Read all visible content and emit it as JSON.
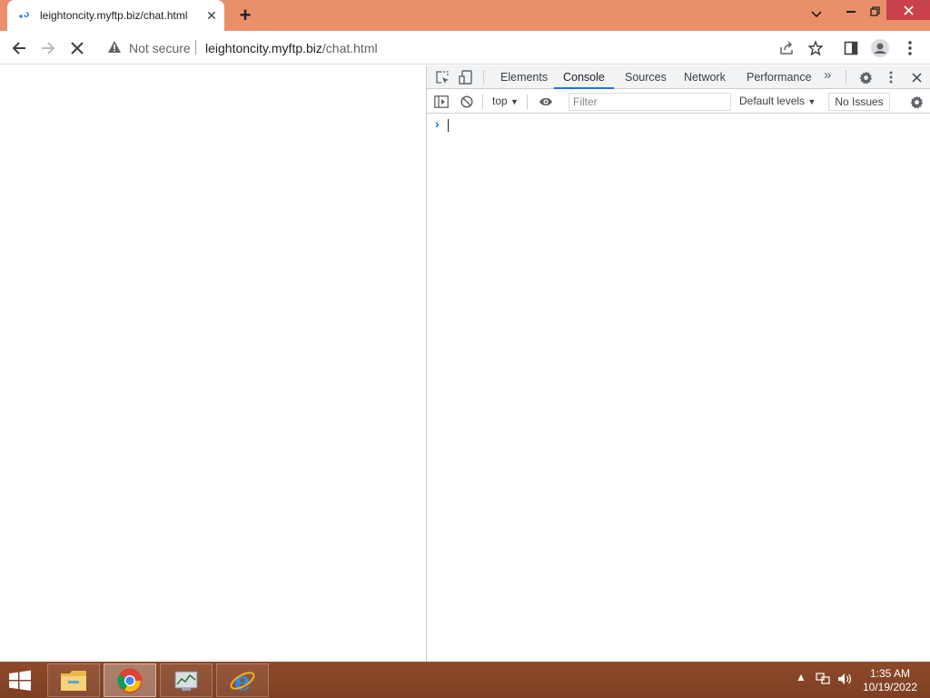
{
  "browser": {
    "tab": {
      "title": "leightoncity.myftp.biz/chat.html",
      "favicon": "loading-favicon-icon"
    },
    "omnibox": {
      "security_label": "Not secure",
      "url_host": "leightoncity.myftp.biz",
      "url_path": "/chat.html"
    },
    "colors": {
      "frame": "#e9906a",
      "close_button": "#c9424b",
      "accent": "#1a73e8"
    }
  },
  "devtools": {
    "tabs": [
      {
        "label": "Elements",
        "active": false
      },
      {
        "label": "Console",
        "active": true
      },
      {
        "label": "Sources",
        "active": false
      },
      {
        "label": "Network",
        "active": false
      },
      {
        "label": "Performance",
        "active": false
      }
    ],
    "toolbar": {
      "context": "top",
      "filter_placeholder": "Filter",
      "levels": "Default levels",
      "issues": "No Issues"
    },
    "console": {
      "prompt": "›"
    }
  },
  "taskbar": {
    "apps": [
      {
        "name": "file-explorer-icon",
        "active": false
      },
      {
        "name": "chrome-icon",
        "active": true
      },
      {
        "name": "task-manager-icon",
        "active": false
      },
      {
        "name": "internet-explorer-icon",
        "active": false
      }
    ],
    "clock": {
      "time": "1:35 AM",
      "date": "10/19/2022"
    }
  }
}
